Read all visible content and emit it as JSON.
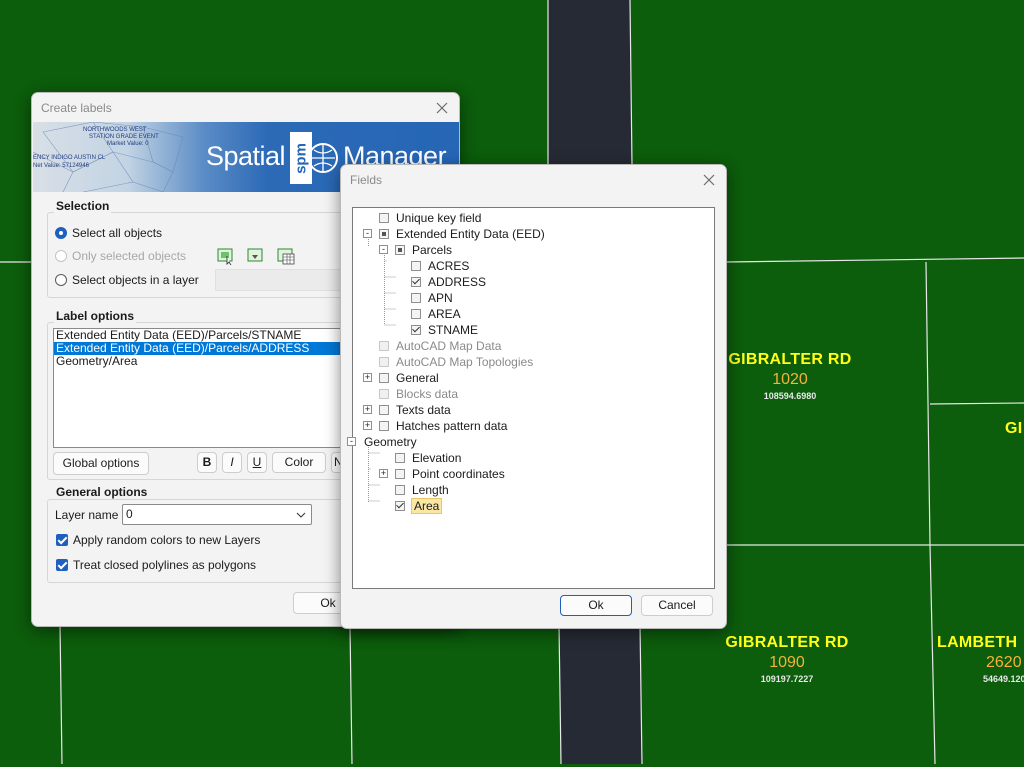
{
  "cad": {
    "labels": [
      {
        "street": "GIBRALTER RD",
        "number": "1020",
        "area": "108594.6980"
      },
      {
        "street": "GIBRALTER RD",
        "number": "1090",
        "area": "109197.7227"
      },
      {
        "street": "LAMBETH",
        "number": "2620",
        "area": "54649.120"
      },
      {
        "street": "GI"
      }
    ]
  },
  "create_labels": {
    "title": "Create labels",
    "banner": {
      "brand_left": "Spatial",
      "brand_right": "Manager",
      "logo_text": "spm",
      "map_text_1": "NORTHWOODS WEST",
      "map_text_2": "STATION GRADE EVENT",
      "map_text_3": "Market Value: 0",
      "map_text_4": "ENCY INDIGO AUSTIN CL",
      "map_text_5": "Net Value: 57124946"
    },
    "selection": {
      "title": "Selection",
      "options": [
        {
          "label": "Select all objects",
          "selected": true,
          "enabled": true
        },
        {
          "label": "Only selected objects",
          "selected": false,
          "enabled": false
        },
        {
          "label": "Select objects in a layer",
          "selected": false,
          "enabled": true
        }
      ]
    },
    "label_options": {
      "title": "Label options",
      "items": [
        {
          "label": "Extended Entity Data (EED)/Parcels/STNAME",
          "selected": false
        },
        {
          "label": "Extended Entity Data (EED)/Parcels/ADDRESS",
          "selected": true
        },
        {
          "label": "Geometry/Area",
          "selected": false
        }
      ],
      "global_button": "Global options",
      "bold": "B",
      "italic": "I",
      "underline": "U",
      "color_button": "Color",
      "truncated_button": "N"
    },
    "general_options": {
      "title": "General options",
      "layer_label": "Layer name",
      "layer_value": "0",
      "checks": [
        {
          "label": "Apply random colors to new Layers",
          "checked": true
        },
        {
          "label": "Treat closed polylines as polygons",
          "checked": true
        }
      ]
    },
    "ok_button": "Ok"
  },
  "fields": {
    "title": "Fields",
    "tree": [
      {
        "label": "Unique key field",
        "state": "unchecked",
        "enabled": true
      },
      {
        "label": "Extended Entity Data (EED)",
        "state": "partial",
        "enabled": true,
        "expander": "-"
      },
      {
        "label": "Parcels",
        "state": "partial",
        "enabled": true,
        "expander": "-"
      },
      {
        "label": "ACRES",
        "state": "unchecked",
        "enabled": true
      },
      {
        "label": "ADDRESS",
        "state": "checked",
        "enabled": true
      },
      {
        "label": "APN",
        "state": "unchecked",
        "enabled": true
      },
      {
        "label": "AREA",
        "state": "unchecked",
        "enabled": true
      },
      {
        "label": "STNAME",
        "state": "checked",
        "enabled": true
      },
      {
        "label": "AutoCAD Map Data",
        "state": "unchecked",
        "enabled": false
      },
      {
        "label": "AutoCAD Map Topologies",
        "state": "unchecked",
        "enabled": false
      },
      {
        "label": "General",
        "state": "unchecked",
        "enabled": true,
        "expander": "+"
      },
      {
        "label": "Blocks data",
        "state": "unchecked",
        "enabled": false
      },
      {
        "label": "Texts data",
        "state": "unchecked",
        "enabled": true,
        "expander": "+"
      },
      {
        "label": "Hatches pattern data",
        "state": "unchecked",
        "enabled": true,
        "expander": "+"
      },
      {
        "label": "Geometry",
        "state": "none",
        "enabled": true,
        "expander": "-"
      },
      {
        "label": "Elevation",
        "state": "unchecked",
        "enabled": true
      },
      {
        "label": "Point coordinates",
        "state": "unchecked",
        "enabled": true,
        "expander": "+"
      },
      {
        "label": "Length",
        "state": "unchecked",
        "enabled": true
      },
      {
        "label": "Area",
        "state": "checked",
        "enabled": true,
        "highlighted": true
      }
    ],
    "ok_button": "Ok",
    "cancel_button": "Cancel"
  }
}
